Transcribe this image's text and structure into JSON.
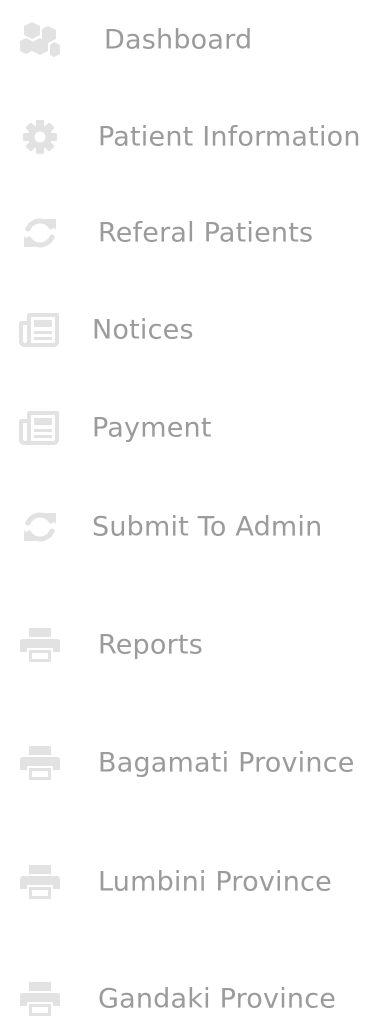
{
  "sidebar": {
    "icon_color": "#e2e2e2",
    "text_color": "#9b9b9b",
    "items": [
      {
        "label": "Dashboard",
        "icon": "cubes-icon"
      },
      {
        "label": "Patient Information",
        "icon": "gear-icon"
      },
      {
        "label": "Referal Patients",
        "icon": "refresh-icon"
      },
      {
        "label": "Notices",
        "icon": "newspaper-icon"
      },
      {
        "label": "Payment",
        "icon": "newspaper-icon"
      },
      {
        "label": "Submit To Admin",
        "icon": "refresh-icon"
      },
      {
        "label": "Reports",
        "icon": "printer-icon"
      },
      {
        "label": "Bagamati Province",
        "icon": "printer-icon"
      },
      {
        "label": "Lumbini Province",
        "icon": "printer-icon"
      },
      {
        "label": "Gandaki Province",
        "icon": "printer-icon"
      }
    ]
  }
}
